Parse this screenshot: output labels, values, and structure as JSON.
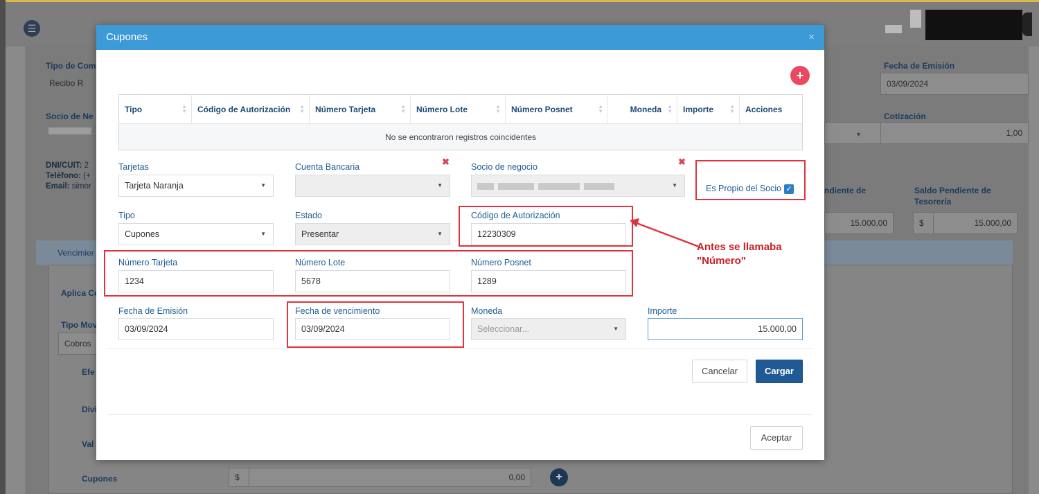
{
  "background": {
    "tipo_comprobante_label": "Tipo de Com",
    "tipo_comprobante_value": "Recibo R",
    "socio_label": "Socio de Ne",
    "dni_label": "DNI/CUIT:",
    "dni_value": "2",
    "telefono_label": "Teléfono:",
    "telefono_value": "(+",
    "email_label": "Email:",
    "email_value": "simor",
    "fecha_emision_label": "Fecha de Emisión",
    "fecha_emision_value": "03/09/2024",
    "cotizacion_label": "Cotización",
    "cotizacion_value": "1,00",
    "pendiente_label": "ndiente de",
    "pendiente_value": "15.000,00",
    "saldo_tesoreria_label_1": "Saldo Pendiente de",
    "saldo_tesoreria_label_2": "Tesorería",
    "saldo_currency": "$",
    "saldo_value": "15.000,00",
    "tab_vencimientos": "Vencimier",
    "aplica_label": "Aplica Co",
    "tipo_mov_label": "Tipo Mov",
    "tipo_mov_value": "Cobros",
    "efe_label": "Efe",
    "divi_label": "Divi",
    "val_label": "Val",
    "cupones_label": "Cupones",
    "cupones_currency": "$",
    "cupones_value": "0,00"
  },
  "modal": {
    "title": "Cupones",
    "close_icon": "×",
    "add_icon": "+",
    "table": {
      "columns": [
        "Tipo",
        "Código de Autorización",
        "Número Tarjeta",
        "Número Lote",
        "Número Posnet",
        "Moneda",
        "Importe",
        "Acciones"
      ],
      "empty_message": "No se encontraron registros coincidentes"
    },
    "form": {
      "tarjetas_label": "Tarjetas",
      "tarjetas_value": "Tarjeta Naranja",
      "cuenta_bancaria_label": "Cuenta Bancaria",
      "cuenta_bancaria_value": "",
      "socio_negocio_label": "Socio de negocio",
      "es_propio_label": "Es Propio del Socio",
      "es_propio_checked": true,
      "tipo_label": "Tipo",
      "tipo_value": "Cupones",
      "estado_label": "Estado",
      "estado_value": "Presentar",
      "codigo_autorizacion_label": "Código de Autorización",
      "codigo_autorizacion_value": "12230309",
      "numero_tarjeta_label": "Número Tarjeta",
      "numero_tarjeta_value": "1234",
      "numero_lote_label": "Número Lote",
      "numero_lote_value": "5678",
      "numero_posnet_label": "Número Posnet",
      "numero_posnet_value": "1289",
      "fecha_emision_label": "Fecha de Emisión",
      "fecha_emision_value": "03/09/2024",
      "fecha_vencimiento_label": "Fecha de vencimiento",
      "fecha_vencimiento_value": "03/09/2024",
      "moneda_label": "Moneda",
      "moneda_placeholder": "Seleccionar...",
      "importe_label": "Importe",
      "importe_value": "15.000,00"
    },
    "cancel_label": "Cancelar",
    "submit_label": "Cargar",
    "accept_label": "Aceptar"
  },
  "annotation": {
    "line1": "Antes se llamaba",
    "line2": "\"Número\"",
    "color": "#cc1f26"
  },
  "colors": {
    "modal_header": "#3c9ad6",
    "primary_button": "#1f5a94",
    "label": "#1d5d96",
    "add_button": "#e84a5f"
  }
}
